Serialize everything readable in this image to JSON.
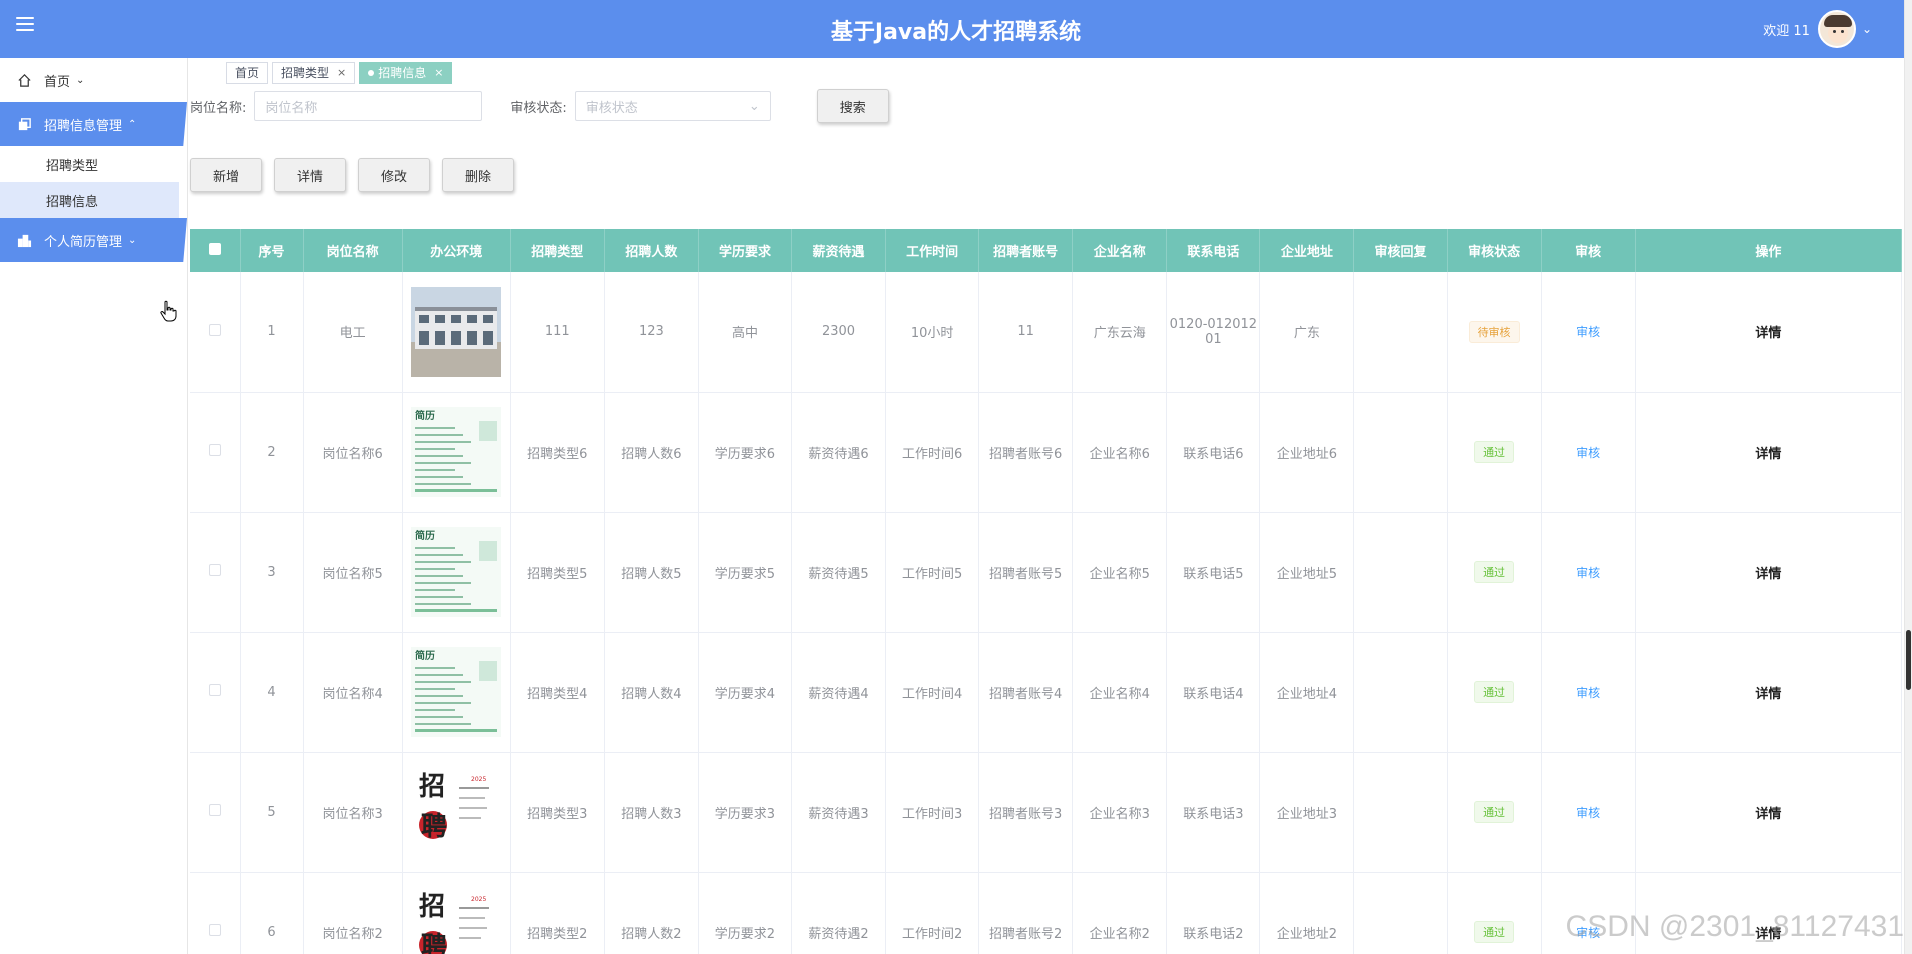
{
  "header": {
    "title": "基于Java的人才招聘系统",
    "welcome": "欢迎 11"
  },
  "sidebar": {
    "items": [
      {
        "label": "首页",
        "icon": "home-icon"
      },
      {
        "label": "招聘信息管理",
        "icon": "copy-icon"
      },
      {
        "label": "个人简历管理",
        "icon": "building-icon"
      }
    ],
    "sub": [
      "招聘类型",
      "招聘信息"
    ]
  },
  "tabs": [
    {
      "label": "首页"
    },
    {
      "label": "招聘类型"
    },
    {
      "label": "招聘信息"
    }
  ],
  "search": {
    "position_label": "岗位名称:",
    "position_placeholder": "岗位名称",
    "status_label": "审核状态:",
    "status_placeholder": "审核状态",
    "search_button": "搜索"
  },
  "actions": {
    "add": "新增",
    "detail": "详情",
    "edit": "修改",
    "delete": "删除"
  },
  "table": {
    "columns": [
      "序号",
      "岗位名称",
      "办公环境",
      "招聘类型",
      "招聘人数",
      "学历要求",
      "薪资待遇",
      "工作时间",
      "招聘者账号",
      "企业名称",
      "联系电话",
      "企业地址",
      "审核回复",
      "审核状态",
      "审核",
      "操作"
    ],
    "rows": [
      {
        "no": "1",
        "name": "电工",
        "img": "building",
        "type": "111",
        "count": "123",
        "edu": "高中",
        "salary": "2300",
        "time": "10小时",
        "account": "11",
        "company": "广东云海",
        "phone": "0120-012012 01",
        "address": "广东",
        "reply": "",
        "status": "待审核",
        "status_type": "pending",
        "audit": "审核",
        "op": "详情"
      },
      {
        "no": "2",
        "name": "岗位名称6",
        "img": "resume",
        "type": "招聘类型6",
        "count": "招聘人数6",
        "edu": "学历要求6",
        "salary": "薪资待遇6",
        "time": "工作时间6",
        "account": "招聘者账号6",
        "company": "企业名称6",
        "phone": "联系电话6",
        "address": "企业地址6",
        "reply": "",
        "status": "通过",
        "status_type": "pass",
        "audit": "审核",
        "op": "详情"
      },
      {
        "no": "3",
        "name": "岗位名称5",
        "img": "resume",
        "type": "招聘类型5",
        "count": "招聘人数5",
        "edu": "学历要求5",
        "salary": "薪资待遇5",
        "time": "工作时间5",
        "account": "招聘者账号5",
        "company": "企业名称5",
        "phone": "联系电话5",
        "address": "企业地址5",
        "reply": "",
        "status": "通过",
        "status_type": "pass",
        "audit": "审核",
        "op": "详情"
      },
      {
        "no": "4",
        "name": "岗位名称4",
        "img": "resume",
        "type": "招聘类型4",
        "count": "招聘人数4",
        "edu": "学历要求4",
        "salary": "薪资待遇4",
        "time": "工作时间4",
        "account": "招聘者账号4",
        "company": "企业名称4",
        "phone": "联系电话4",
        "address": "企业地址4",
        "reply": "",
        "status": "通过",
        "status_type": "pass",
        "audit": "审核",
        "op": "详情"
      },
      {
        "no": "5",
        "name": "岗位名称3",
        "img": "poster",
        "type": "招聘类型3",
        "count": "招聘人数3",
        "edu": "学历要求3",
        "salary": "薪资待遇3",
        "time": "工作时间3",
        "account": "招聘者账号3",
        "company": "企业名称3",
        "phone": "联系电话3",
        "address": "企业地址3",
        "reply": "",
        "status": "通过",
        "status_type": "pass",
        "audit": "审核",
        "op": "详情"
      },
      {
        "no": "6",
        "name": "岗位名称2",
        "img": "poster",
        "type": "招聘类型2",
        "count": "招聘人数2",
        "edu": "学历要求2",
        "salary": "薪资待遇2",
        "time": "工作时间2",
        "account": "招聘者账号2",
        "company": "企业名称2",
        "phone": "联系电话2",
        "address": "企业地址2",
        "reply": "",
        "status": "通过",
        "status_type": "pass",
        "audit": "审核",
        "op": "详情"
      }
    ]
  },
  "watermark": "CSDN @2301_81127431",
  "colors": {
    "header": "#5b8eed",
    "table_header": "#71c4b7",
    "active_tab": "#8cd0c2"
  }
}
